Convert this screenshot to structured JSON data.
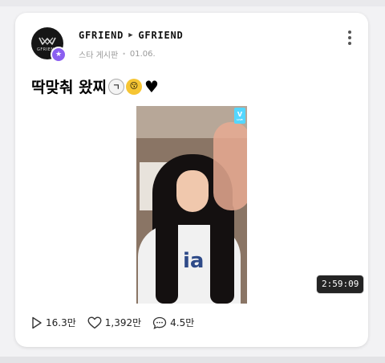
{
  "post": {
    "author": "GFRIEND",
    "board_owner": "GFRIEND",
    "avatar_caption": "GFRIEND",
    "board_name": "스타 게시판",
    "date": "01.06.",
    "text": "딱맞춰 왔찌",
    "emojis": {
      "clock": "ㄱ",
      "face": "😗",
      "heart": "♥"
    }
  },
  "video": {
    "duration": "2:59:09",
    "vlive_label": "V",
    "vlive_sub": "LIVE",
    "shirt_print": "ia"
  },
  "stats": {
    "views": "16.3만",
    "likes": "1,392만",
    "comments": "4.5만"
  },
  "icons": {
    "more": "more-vertical-icon",
    "play": "play-icon",
    "heart": "heart-outline-icon",
    "comment": "comment-icon",
    "badge": "star-icon"
  },
  "colors": {
    "badge_purple": "#8b5ff0",
    "duration_bg": "#242424"
  }
}
